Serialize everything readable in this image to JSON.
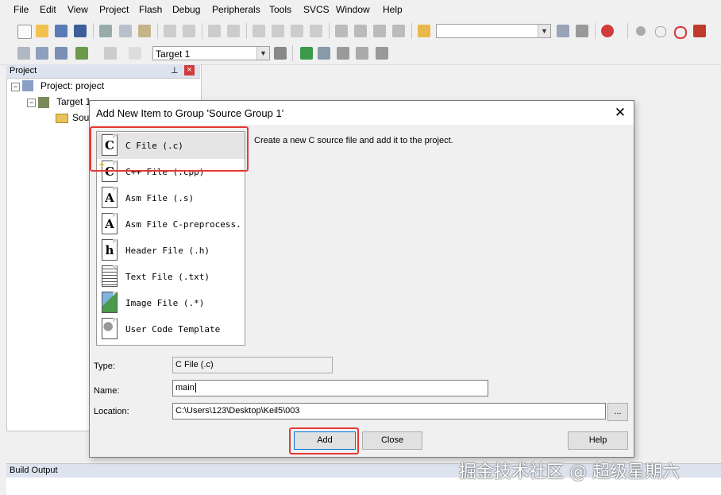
{
  "menu": [
    "File",
    "Edit",
    "View",
    "Project",
    "Flash",
    "Debug",
    "Peripherals",
    "Tools",
    "SVCS",
    "Window",
    "Help"
  ],
  "toolbar2": {
    "target_combo": "Target 1"
  },
  "project_panel": {
    "title": "Project",
    "pin_glyph": "⊥",
    "close_glyph": "×",
    "tree": {
      "root": "Project: project",
      "target": "Target 1",
      "group": "Sou"
    }
  },
  "build_output": {
    "title": "Build Output"
  },
  "dialog": {
    "title": "Add New Item to Group 'Source Group 1'",
    "close_glyph": "✕",
    "items": [
      {
        "label": "C File (.c)",
        "icon": "C",
        "icon_name": "c-file-icon"
      },
      {
        "label": "C++ File (.cpp)",
        "icon": "C",
        "icon_name": "cpp-file-icon"
      },
      {
        "label": "Asm File (.s)",
        "icon": "A",
        "icon_name": "asm-file-icon"
      },
      {
        "label": "Asm File C-preprocess...",
        "icon": "A",
        "icon_name": "asm-preprocess-file-icon"
      },
      {
        "label": "Header File (.h)",
        "icon": "h",
        "icon_name": "header-file-icon"
      },
      {
        "label": "Text File (.txt)",
        "icon": "",
        "icon_name": "text-file-icon"
      },
      {
        "label": "Image File (.*)",
        "icon": "",
        "icon_name": "image-file-icon"
      },
      {
        "label": "User Code Template",
        "icon": "",
        "icon_name": "user-code-template-icon"
      }
    ],
    "description": "Create a new C source file and add it to the project.",
    "type_label": "Type:",
    "type_value": "C File (.c)",
    "name_label": "Name:",
    "name_value": "main",
    "location_label": "Location:",
    "location_value": "C:\\Users\\123\\Desktop\\Keil5\\003",
    "browse_label": "...",
    "add_label": "Add",
    "close_label": "Close",
    "help_label": "Help"
  },
  "watermark": "掘金技术社区 @ 超级星期六",
  "colors": {
    "highlight_box": "#e53935",
    "panel_header": "#dce3ee"
  }
}
